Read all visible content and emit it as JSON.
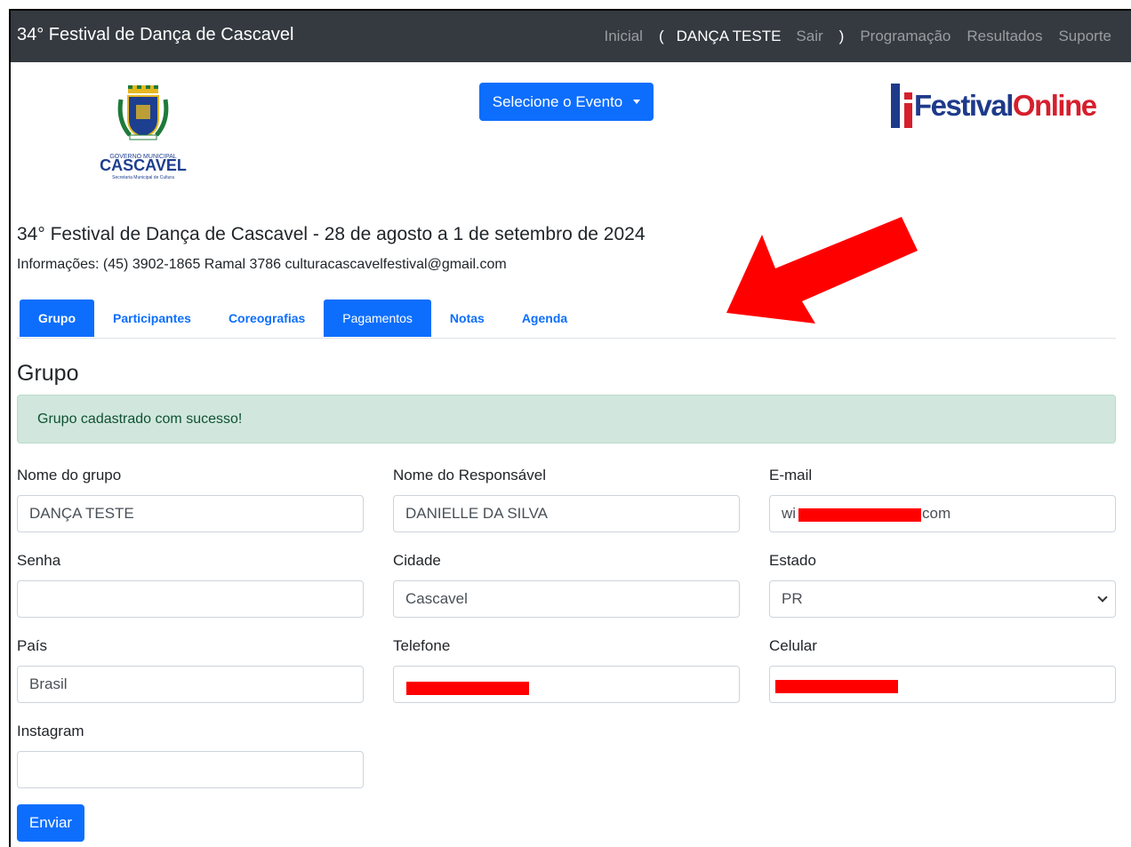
{
  "navbar": {
    "brand": "34° Festival de Dança de Cascavel",
    "links": {
      "inicial": "Inicial",
      "open_paren": "(",
      "user": "DANÇA TESTE",
      "sair": "Sair",
      "close_paren": ")",
      "programacao": "Programação",
      "resultados": "Resultados",
      "suporte": "Suporte"
    }
  },
  "header": {
    "event_button": "Selecione o Evento",
    "logo_left": {
      "line1": "GOVERNO MUNICIPAL",
      "line2": "CASCAVEL",
      "line3": "Secretaria Municipal de Cultura"
    },
    "logo_right": {
      "part1": "Festival",
      "part2": "Online"
    }
  },
  "event": {
    "title": "34° Festival de Dança de Cascavel - 28 de agosto a 1 de setembro de 2024",
    "info": "Informações: (45) 3902-1865 Ramal 3786 culturacascavelfestival@gmail.com"
  },
  "tabs": [
    {
      "label": "Grupo"
    },
    {
      "label": "Participantes"
    },
    {
      "label": "Coreografias"
    },
    {
      "label": "Pagamentos"
    },
    {
      "label": "Notas"
    },
    {
      "label": "Agenda"
    }
  ],
  "section": {
    "title": "Grupo",
    "alert": "Grupo cadastrado com sucesso!"
  },
  "form": {
    "nome_grupo": {
      "label": "Nome do grupo",
      "value": "DANÇA TESTE"
    },
    "responsavel": {
      "label": "Nome do Responsável",
      "value": "DANIELLE DA SILVA"
    },
    "email": {
      "label": "E-mail",
      "value_start": "wi",
      "value_end": "com"
    },
    "senha": {
      "label": "Senha",
      "value": ""
    },
    "cidade": {
      "label": "Cidade",
      "value": "Cascavel"
    },
    "estado": {
      "label": "Estado",
      "value": "PR"
    },
    "pais": {
      "label": "País",
      "value": "Brasil"
    },
    "telefone": {
      "label": "Telefone",
      "value": ""
    },
    "celular": {
      "label": "Celular",
      "value": ""
    },
    "instagram": {
      "label": "Instagram",
      "value": ""
    },
    "submit": "Enviar"
  },
  "colors": {
    "navbar": "#343a40",
    "primary": "#0d6efd",
    "alert_bg": "#d1e7dd",
    "alert_text": "#0f5132",
    "redaction": "#ff0000",
    "annotation_arrow": "#ff0000"
  }
}
